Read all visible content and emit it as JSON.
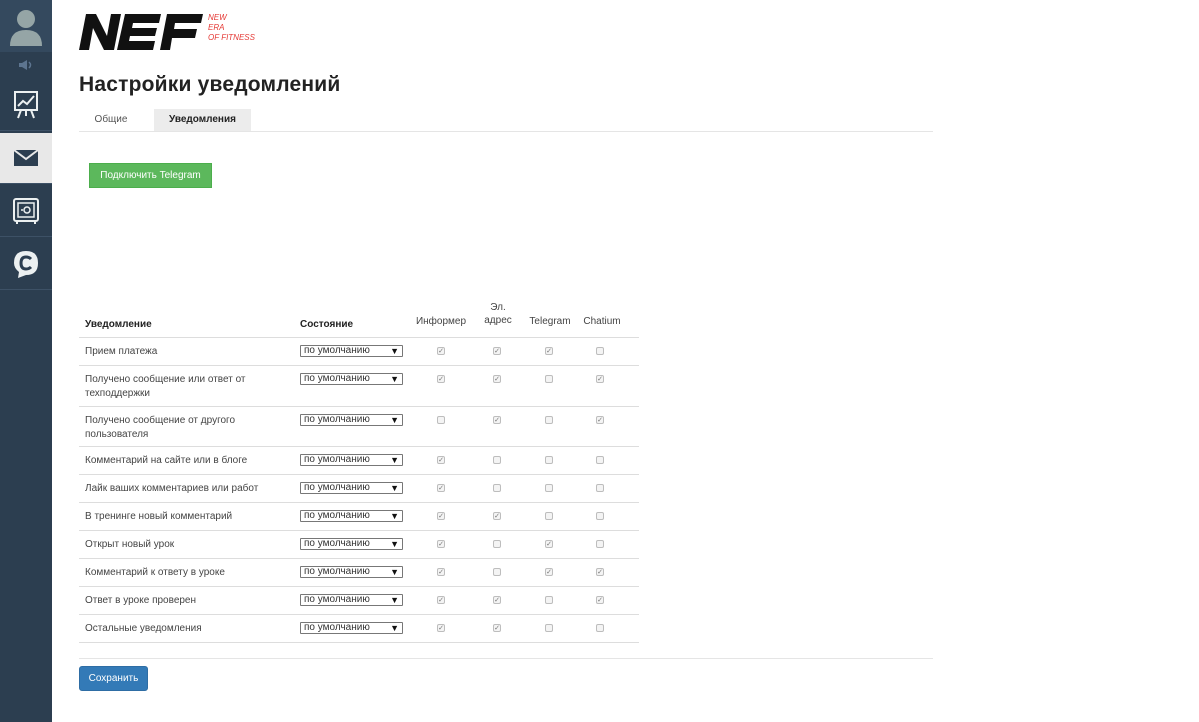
{
  "logo": {
    "lines": [
      "NEW",
      "ERA",
      "OF FITNESS"
    ]
  },
  "page": {
    "title": "Настройки уведомлений"
  },
  "tabs": [
    {
      "label": "Общие",
      "active": false
    },
    {
      "label": "Уведомления",
      "active": true
    }
  ],
  "telegram_button": {
    "label": "Подключить Telegram"
  },
  "table": {
    "headers": {
      "notification": "Уведомление",
      "state": "Состояние",
      "informer": "Информер",
      "email_line1": "Эл.",
      "email_line2": "адрес",
      "telegram": "Telegram",
      "chatium": "Chatium"
    },
    "rows": [
      {
        "label_lines": [
          "Прием платежа"
        ],
        "state": "по умолчанию",
        "checks": [
          true,
          true,
          true,
          false
        ]
      },
      {
        "label_lines": [
          "Получено сообщение или ответ от",
          "техподдержки"
        ],
        "state": "по умолчанию",
        "checks": [
          true,
          true,
          false,
          true
        ]
      },
      {
        "label_lines": [
          "Получено сообщение от другого",
          "пользователя"
        ],
        "state": "по умолчанию",
        "checks": [
          false,
          true,
          false,
          true
        ]
      },
      {
        "label_lines": [
          "Комментарий на сайте или в блоге"
        ],
        "state": "по умолчанию",
        "checks": [
          true,
          false,
          false,
          false
        ]
      },
      {
        "label_lines": [
          "Лайк ваших комментариев или работ"
        ],
        "state": "по умолчанию",
        "checks": [
          true,
          false,
          false,
          false
        ]
      },
      {
        "label_lines": [
          "В тренинге новый комментарий"
        ],
        "state": "по умолчанию",
        "checks": [
          true,
          true,
          false,
          false
        ]
      },
      {
        "label_lines": [
          "Открыт новый урок"
        ],
        "state": "по умолчанию",
        "checks": [
          true,
          false,
          true,
          false
        ]
      },
      {
        "label_lines": [
          "Комментарий к ответу в уроке"
        ],
        "state": "по умолчанию",
        "checks": [
          true,
          false,
          true,
          true
        ]
      },
      {
        "label_lines": [
          "Ответ в уроке проверен"
        ],
        "state": "по умолчанию",
        "checks": [
          true,
          true,
          false,
          true
        ]
      },
      {
        "label_lines": [
          "Остальные уведомления"
        ],
        "state": "по умолчанию",
        "checks": [
          true,
          true,
          false,
          false
        ]
      }
    ]
  },
  "save_button": {
    "label": "Сохранить"
  },
  "colors": {
    "sidebar": "#2c3e50",
    "accent_green": "#5cb85c",
    "accent_blue": "#337ab7",
    "logo_red": "#e53935"
  },
  "icons": [
    "user-avatar-icon",
    "speaker-icon",
    "chart-board-icon",
    "mail-icon",
    "safe-icon",
    "chatium-icon",
    "select-arrow-icon",
    "check-icon"
  ]
}
